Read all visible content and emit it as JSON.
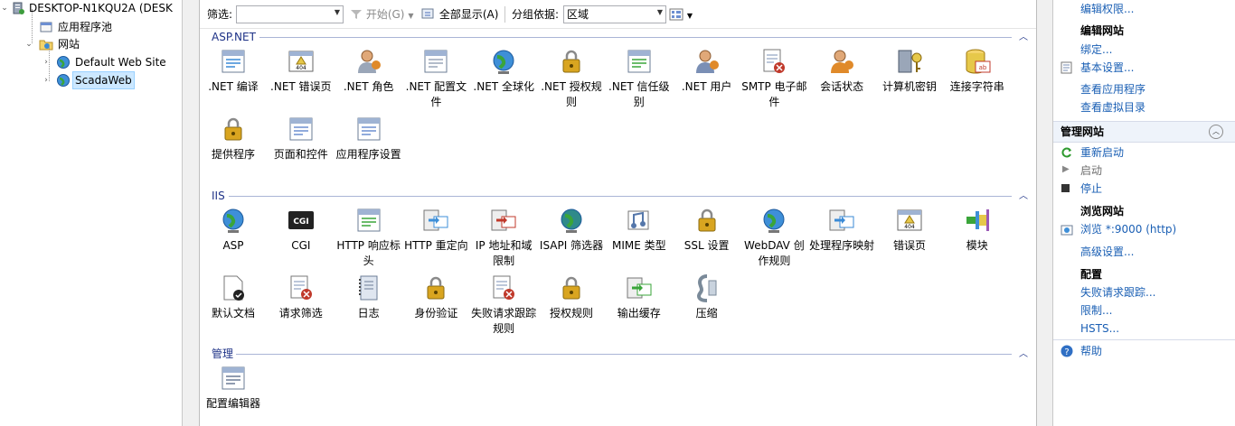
{
  "tree": {
    "root": "DESKTOP-N1KQU2A (DESK",
    "app_pools": "应用程序池",
    "sites": "网站",
    "site1": "Default Web Site",
    "site2": "ScadaWeb"
  },
  "filterbar": {
    "filter_label": "筛选:",
    "start": "开始(G)",
    "show_all": "全部显示(A)",
    "group_by": "分组依据:",
    "group_value": "区域"
  },
  "sections": [
    {
      "title": "ASP.NET",
      "items": [
        ".NET 编译",
        ".NET 错误页",
        ".NET 角色",
        ".NET 配置文件",
        ".NET 全球化",
        ".NET 授权规则",
        ".NET 信任级别",
        ".NET 用户",
        "SMTP 电子邮件",
        "会话状态",
        "计算机密钥",
        "连接字符串",
        "提供程序",
        "页面和控件",
        "应用程序设置"
      ]
    },
    {
      "title": "IIS",
      "items": [
        "ASP",
        "CGI",
        "HTTP 响应标头",
        "HTTP 重定向",
        "IP 地址和域限制",
        "ISAPI 筛选器",
        "MIME 类型",
        "SSL 设置",
        "WebDAV 创作规则",
        "处理程序映射",
        "错误页",
        "模块",
        "默认文档",
        "请求筛选",
        "日志",
        "身份验证",
        "失败请求跟踪规则",
        "授权规则",
        "输出缓存",
        "压缩"
      ]
    },
    {
      "title": "管理",
      "items": [
        "配置编辑器"
      ]
    }
  ],
  "actions": {
    "edit_perm": "编辑权限...",
    "edit_site": "编辑网站",
    "bindings": "绑定...",
    "basic": "基本设置...",
    "view_app": "查看应用程序",
    "view_vdir": "查看虚拟目录",
    "manage_site": "管理网站",
    "restart": "重新启动",
    "start": "启动",
    "stop": "停止",
    "browse_site": "浏览网站",
    "browse": "浏览 *:9000 (http)",
    "advanced": "高级设置...",
    "config": "配置",
    "failed_trace": "失败请求跟踪...",
    "limits": "限制...",
    "hsts": "HSTS...",
    "help": "帮助"
  },
  "colors": {
    "link": "#1a5fb4",
    "section": "#1e3287",
    "selection": "#cce8ff"
  }
}
